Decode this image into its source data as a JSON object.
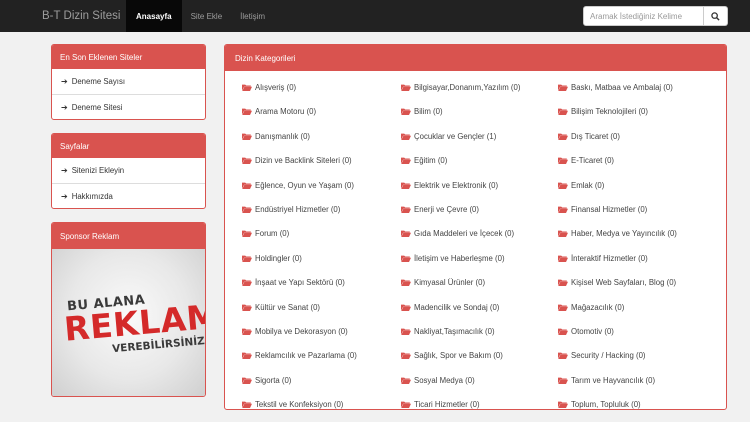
{
  "navbar": {
    "brand": "B-T Dizin Sitesi",
    "links": [
      "Anasayfa",
      "Site Ekle",
      "İletişim"
    ],
    "search_placeholder": "Aramak İstediğiniz Kelime"
  },
  "sidebar": {
    "latest": {
      "title": "En Son Eklenen Siteler",
      "items": [
        "Deneme Sayısı",
        "Deneme Sitesi"
      ]
    },
    "pages": {
      "title": "Sayfalar",
      "items": [
        "Sitenizi Ekleyin",
        "Hakkımızda"
      ]
    },
    "sponsor": {
      "title": "Sponsor Reklam",
      "ad_line1": "BU ALANA",
      "ad_line2": "REKLAM",
      "ad_line3": "VEREBİLİRSİNİZ!"
    }
  },
  "categories": {
    "title": "Dizin Kategorileri",
    "columns": [
      [
        "Alışveriş (0)",
        "Arama Motoru (0)",
        "Danışmanlık (0)",
        "Dizin ve Backlink Siteleri (0)",
        "Eğlence, Oyun ve Yaşam (0)",
        "Endüstriyel Hizmetler (0)",
        "Forum (0)",
        "Holdingler (0)",
        "İnşaat ve Yapı Sektörü (0)",
        "Kültür ve Sanat (0)",
        "Mobilya ve Dekorasyon (0)",
        "Reklamcılık ve Pazarlama (0)",
        "Sigorta (0)",
        "Tekstil ve Konfeksiyon (0)"
      ],
      [
        "Bilgisayar,Donanım,Yazılım (0)",
        "Bilim (0)",
        "Çocuklar ve Gençler (1)",
        "Eğitim (0)",
        "Elektrik ve Elektronik (0)",
        "Enerji ve Çevre (0)",
        "Gıda Maddeleri ve İçecek (0)",
        "İletişim ve Haberleşme (0)",
        "Kimyasal Ürünler (0)",
        "Madencilik ve Sondaj (0)",
        "Nakliyat,Taşımacılık (0)",
        "Sağlık, Spor ve Bakım (0)",
        "Sosyal Medya (0)",
        "Ticari Hizmetler (0)"
      ],
      [
        "Baskı, Matbaa ve Ambalaj (0)",
        "Bilişim Teknolojileri (0)",
        "Dış Ticaret (0)",
        "E-Ticaret (0)",
        "Emlak (0)",
        "Finansal Hizmetler (0)",
        "Haber, Medya ve Yayıncılık (0)",
        "İnteraktif Hizmetler (0)",
        "Kişisel Web Sayfaları, Blog (0)",
        "Mağazacılık (0)",
        "Otomotiv (0)",
        "Security / Hacking (0)",
        "Tarım ve Hayvancılık (0)",
        "Toplum, Topluluk (0)"
      ]
    ]
  },
  "colors": {
    "accent": "#d9534f",
    "navbar": "#222222"
  },
  "icons": {
    "folder": "folder-open-icon",
    "arrow": "arrow-right-icon",
    "search": "search-icon"
  }
}
